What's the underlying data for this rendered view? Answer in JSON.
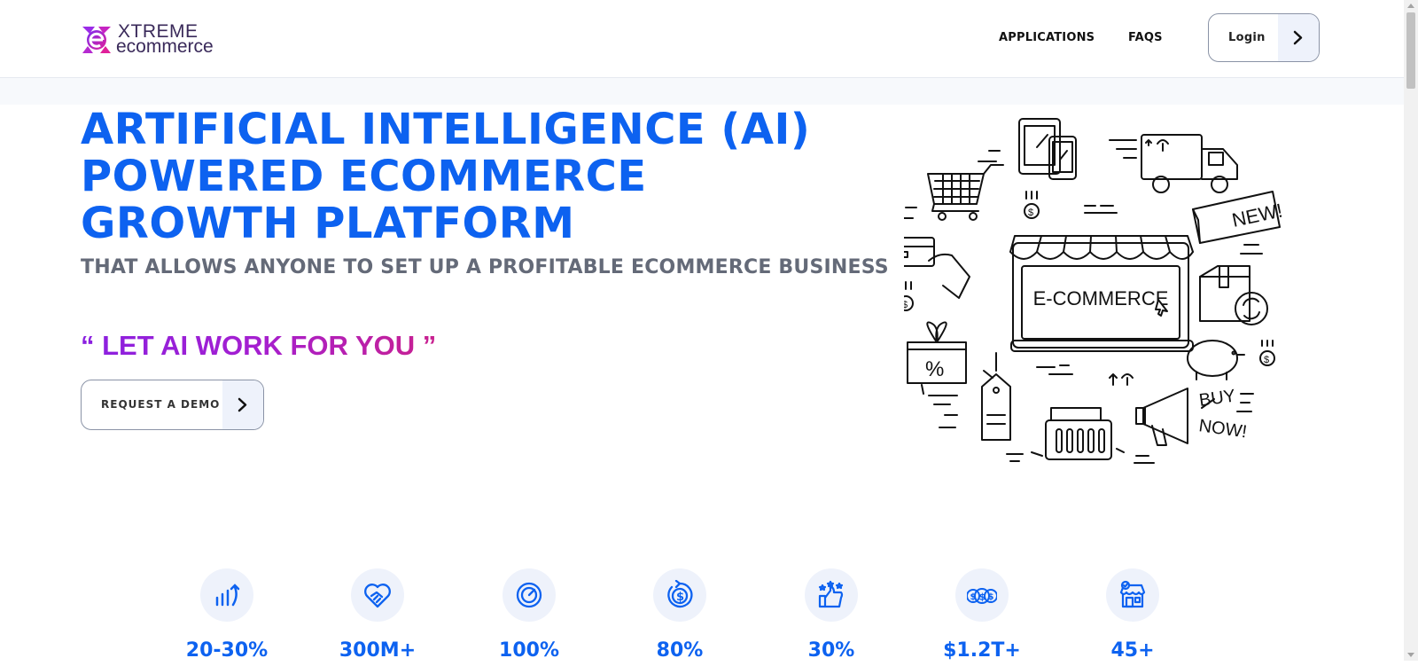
{
  "header": {
    "logo": {
      "line1": "XTREME",
      "line2": "ecommerce"
    },
    "nav": [
      {
        "label": "APPLICATIONS"
      },
      {
        "label": "FAQS"
      }
    ],
    "login_label": "Login"
  },
  "hero": {
    "title": "ARTIFICIAL INTELLIGENCE (AI) POWERED ECOMMERCE GROWTH PLATFORM",
    "subtitle": "THAT ALLOWS ANYONE TO SET UP A PROFITABLE ECOMMERCE BUSINESS",
    "quote": "“ LET AI WORK FOR YOU ”",
    "demo_label": "REQUEST A DEMO",
    "illustration_label": "E-COMMERCE",
    "illustration_tags": {
      "new": "NEW!",
      "buy1": "BUY",
      "buy2": "NOW!"
    }
  },
  "stats": [
    {
      "icon": "growth-chart-icon",
      "value": "20-30%"
    },
    {
      "icon": "handshake-heart-icon",
      "value": "300M+"
    },
    {
      "icon": "speedometer-icon",
      "value": "100%"
    },
    {
      "icon": "dollar-refresh-icon",
      "value": "80%"
    },
    {
      "icon": "thumbs-up-stars-icon",
      "value": "30%"
    },
    {
      "icon": "coins-icon",
      "value": "$1.2T+"
    },
    {
      "icon": "storefront-icon",
      "value": "45+"
    }
  ],
  "colors": {
    "primary_blue": "#0d62f0",
    "subtitle_gray": "#646a78",
    "quote_gradient_start": "#8a20e0",
    "quote_gradient_end": "#c9208f",
    "icon_circle_bg": "#eef2fb"
  }
}
